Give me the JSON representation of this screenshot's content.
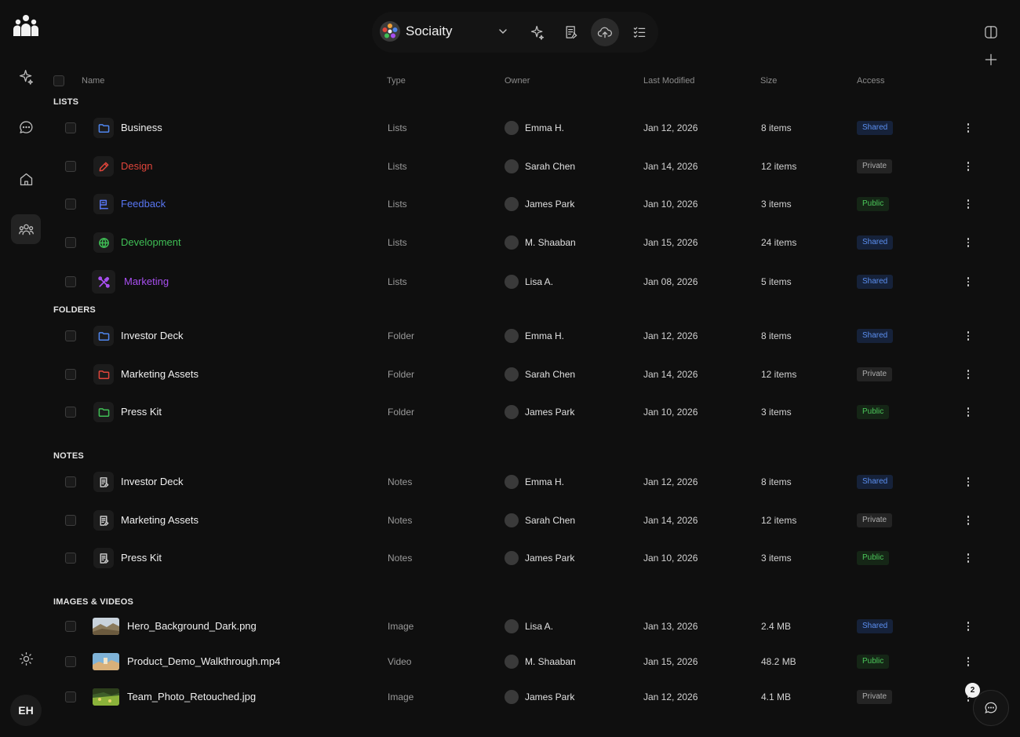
{
  "workspace": {
    "name": "Sociaity"
  },
  "user": {
    "initials": "EH"
  },
  "chat": {
    "unread_count": "2"
  },
  "columns": {
    "name": "Name",
    "type": "Type",
    "owner": "Owner",
    "modified": "Last Modified",
    "size": "Size",
    "access": "Access"
  },
  "sections": {
    "lists": {
      "title": "LISTS",
      "rows": [
        {
          "name": "Business",
          "type": "Lists",
          "owner": "Emma H.",
          "modified": "Jan 12, 2026",
          "size": "8 items",
          "access": "Shared",
          "icon": "folder-icon",
          "color": "#4f86ef"
        },
        {
          "name": "Design",
          "type": "Lists",
          "owner": "Sarah Chen",
          "modified": "Jan 14, 2026",
          "size": "12 items",
          "access": "Private",
          "icon": "pencil-icon",
          "color": "#e0453b"
        },
        {
          "name": "Feedback",
          "type": "Lists",
          "owner": "James Park",
          "modified": "Jan 10, 2026",
          "size": "3 items",
          "access": "Public",
          "icon": "feedback-icon",
          "color": "#5876f2"
        },
        {
          "name": "Development",
          "type": "Lists",
          "owner": "M. Shaaban",
          "modified": "Jan 15, 2026",
          "size": "24 items",
          "access": "Shared",
          "icon": "globe-icon",
          "color": "#3fbf55"
        },
        {
          "name": "Marketing",
          "type": "Lists",
          "owner": "Lisa A.",
          "modified": "Jan 08, 2026",
          "size": "5 items",
          "access": "Shared",
          "icon": "marketing-icon",
          "color": "#a84ff0"
        }
      ]
    },
    "folders": {
      "title": "FOLDERS",
      "rows": [
        {
          "name": "Investor Deck",
          "type": "Folder",
          "owner": "Emma H.",
          "modified": "Jan 12, 2026",
          "size": "8 items",
          "access": "Shared",
          "color": "#4f86ef"
        },
        {
          "name": "Marketing Assets",
          "type": "Folder",
          "owner": "Sarah Chen",
          "modified": "Jan 14, 2026",
          "size": "12 items",
          "access": "Private",
          "color": "#e0453b"
        },
        {
          "name": "Press Kit",
          "type": "Folder",
          "owner": "James Park",
          "modified": "Jan 10, 2026",
          "size": "3 items",
          "access": "Public",
          "color": "#3fbf55"
        }
      ]
    },
    "notes": {
      "title": "NOTES",
      "rows": [
        {
          "name": "Investor Deck",
          "type": "Notes",
          "owner": "Emma H.",
          "modified": "Jan 12, 2026",
          "size": "8 items",
          "access": "Shared"
        },
        {
          "name": "Marketing Assets",
          "type": "Notes",
          "owner": "Sarah Chen",
          "modified": "Jan 14, 2026",
          "size": "12 items",
          "access": "Private"
        },
        {
          "name": "Press Kit",
          "type": "Notes",
          "owner": "James Park",
          "modified": "Jan 10, 2026",
          "size": "3 items",
          "access": "Public"
        }
      ]
    },
    "media": {
      "title": "IMAGES & VIDEOS",
      "rows": [
        {
          "name": "Hero_Background_Dark.png",
          "type": "Image",
          "owner": "Lisa A.",
          "modified": "Jan 13, 2026",
          "size": "2.4 MB",
          "access": "Shared"
        },
        {
          "name": "Product_Demo_Walkthrough.mp4",
          "type": "Video",
          "owner": "M. Shaaban",
          "modified": "Jan 15, 2026",
          "size": "48.2 MB",
          "access": "Public"
        },
        {
          "name": "Team_Photo_Retouched.jpg",
          "type": "Image",
          "owner": "James Park",
          "modified": "Jan 12, 2026",
          "size": "4.1 MB",
          "access": "Private"
        }
      ]
    }
  }
}
